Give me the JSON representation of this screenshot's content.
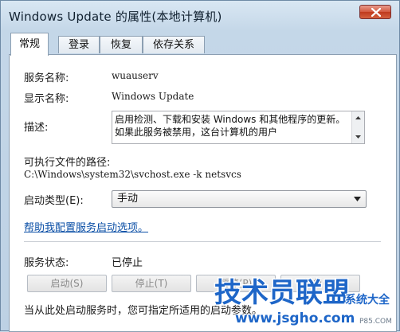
{
  "window": {
    "title": "Windows Update 的属性(本地计算机)"
  },
  "tabs": [
    {
      "label": "常规"
    },
    {
      "label": "登录"
    },
    {
      "label": "恢复"
    },
    {
      "label": "依存关系"
    }
  ],
  "general": {
    "service_name_label": "服务名称:",
    "service_name_value": "wuauserv",
    "display_name_label": "显示名称:",
    "display_name_value": "Windows Update",
    "description_label": "描述:",
    "description_value": "启用检测、下载和安装 Windows 和其他程序的更新。如果此服务被禁用，这台计算机的用户",
    "path_label": "可执行文件的路径:",
    "path_value": "C:\\Windows\\system32\\svchost.exe -k netsvcs",
    "startup_type_label": "启动类型(E):",
    "startup_type_value": "手动",
    "help_link": "帮助我配置服务启动选项。",
    "status_label": "服务状态:",
    "status_value": "已停止",
    "buttons": {
      "start": "启动(S)",
      "stop": "停止(T)",
      "pause": "暂停(P)",
      "resume": "恢复(R)"
    },
    "hint_text": "当从此处启动服务时，您可指定所适用的启动参数。"
  },
  "watermark": {
    "main": "技术员联盟",
    "side": "系统大全",
    "url": "www.jsgho.com",
    "small": "P85.COM"
  },
  "colors": {
    "watermark_blue": "#1e66c8",
    "link": "#0b4fa6",
    "close_button": "#c94a2f"
  }
}
